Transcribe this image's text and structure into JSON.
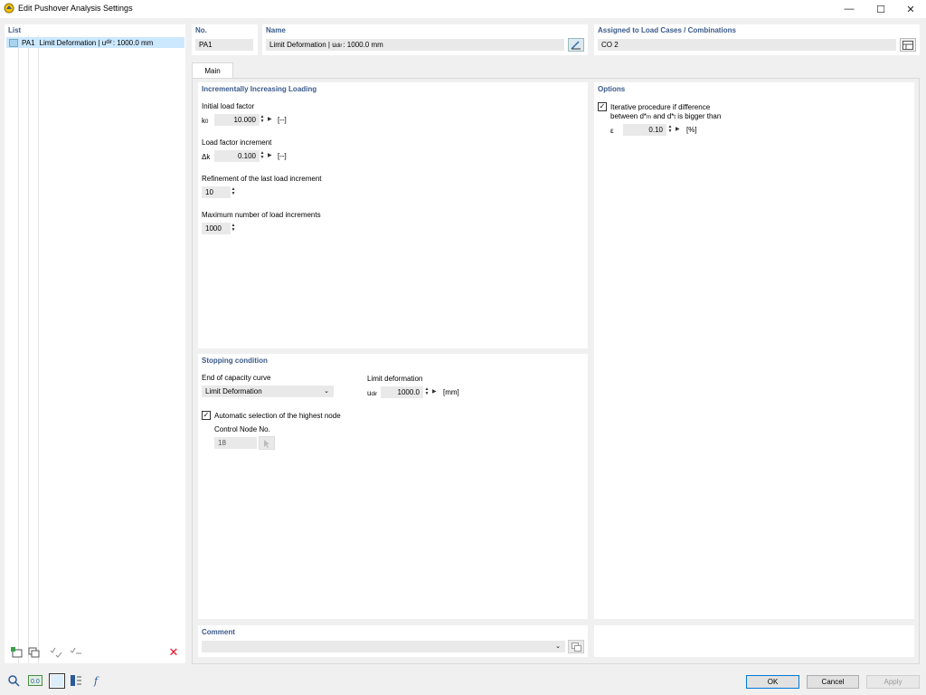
{
  "window": {
    "title": "Edit Pushover Analysis Settings"
  },
  "list": {
    "header": "List",
    "items": [
      {
        "no": "PA1",
        "name": "Limit Deformation | u",
        "sub": "dir",
        "value": ": 1000.0 mm"
      }
    ]
  },
  "header": {
    "no_label": "No.",
    "no_value": "PA1",
    "name_label": "Name",
    "name_value": "Limit Deformation | u",
    "name_sub": "dir",
    "name_tail": ": 1000.0 mm",
    "assigned_label": "Assigned to Load Cases / Combinations",
    "assigned_value": "CO 2"
  },
  "tabs": [
    {
      "label": "Main",
      "active": true
    }
  ],
  "loading": {
    "title": "Incrementally Increasing Loading",
    "initial_label": "Initial load factor",
    "k0_symbol": "k",
    "k0_sub": "0",
    "k0_value": "10.000",
    "k0_unit": "[--]",
    "increment_label": "Load factor increment",
    "dk_symbol": "Δk",
    "dk_value": "0.100",
    "dk_unit": "[--]",
    "refinement_label": "Refinement of the last load increment",
    "refinement_value": "10",
    "max_label": "Maximum number of load increments",
    "max_value": "1000"
  },
  "options": {
    "title": "Options",
    "iterative_label_1": "Iterative procedure if difference",
    "iterative_label_2a": "between d*",
    "iterative_sub_m": "m",
    "iterative_label_2b": " and d*",
    "iterative_sub_t": "t",
    "iterative_label_2c": " is bigger than",
    "iterative_checked": true,
    "eps_symbol": "ε",
    "eps_value": "0.10",
    "eps_unit": "[%]"
  },
  "stopping": {
    "title": "Stopping condition",
    "end_label": "End of capacity curve",
    "end_value": "Limit Deformation",
    "limit_label": "Limit deformation",
    "u_symbol": "u",
    "u_sub": "dir",
    "u_value": "1000.0",
    "u_unit": "[mm]",
    "auto_label": "Automatic selection of the highest node",
    "auto_checked": true,
    "control_label": "Control Node No.",
    "control_value": "18"
  },
  "comment": {
    "title": "Comment",
    "value": ""
  },
  "buttons": {
    "ok": "OK",
    "cancel": "Cancel",
    "apply": "Apply"
  },
  "colors": {
    "accent": "#3b5a8a",
    "selection": "#cce8ff",
    "delete": "#e81123",
    "primary_border": "#0078d7"
  }
}
